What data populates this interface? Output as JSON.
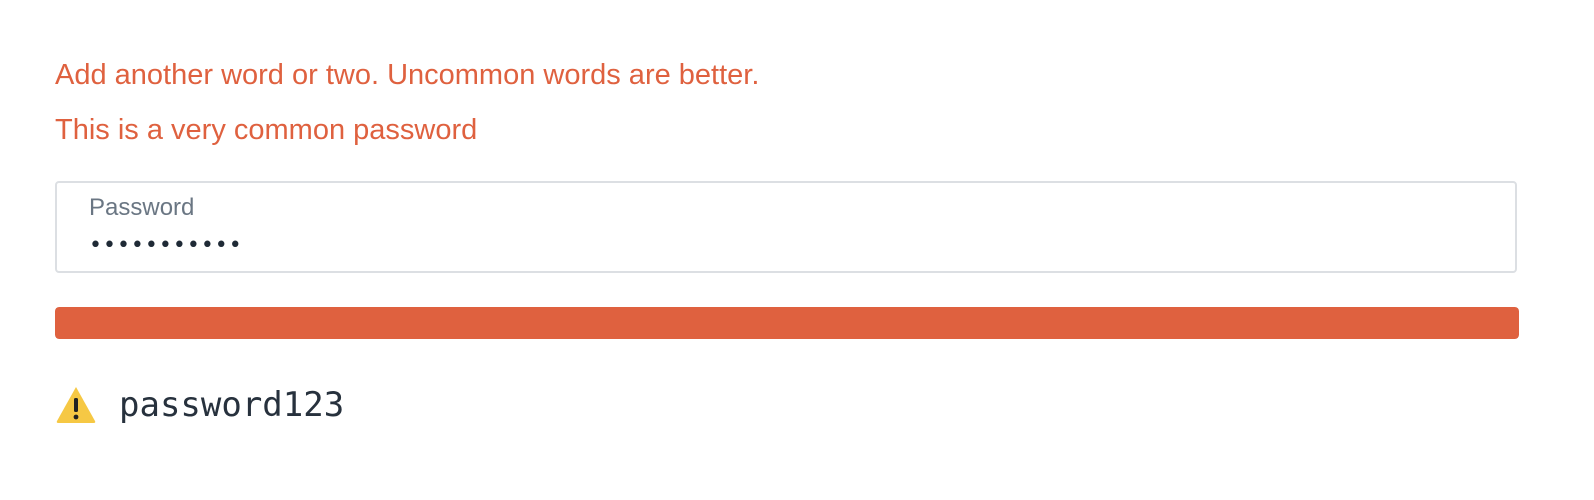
{
  "feedback": {
    "suggestion": "Add another word or two. Uncommon words are better.",
    "warning": "This is a very common password"
  },
  "password_field": {
    "label": "Password",
    "value": "password123"
  },
  "strength_meter": {
    "fill_fraction": 1.0,
    "color": "#df613f"
  },
  "entered_password": {
    "icon": "warning-icon",
    "text": "password123"
  },
  "colors": {
    "error": "#df613f",
    "warning_icon": "#f6c844"
  }
}
